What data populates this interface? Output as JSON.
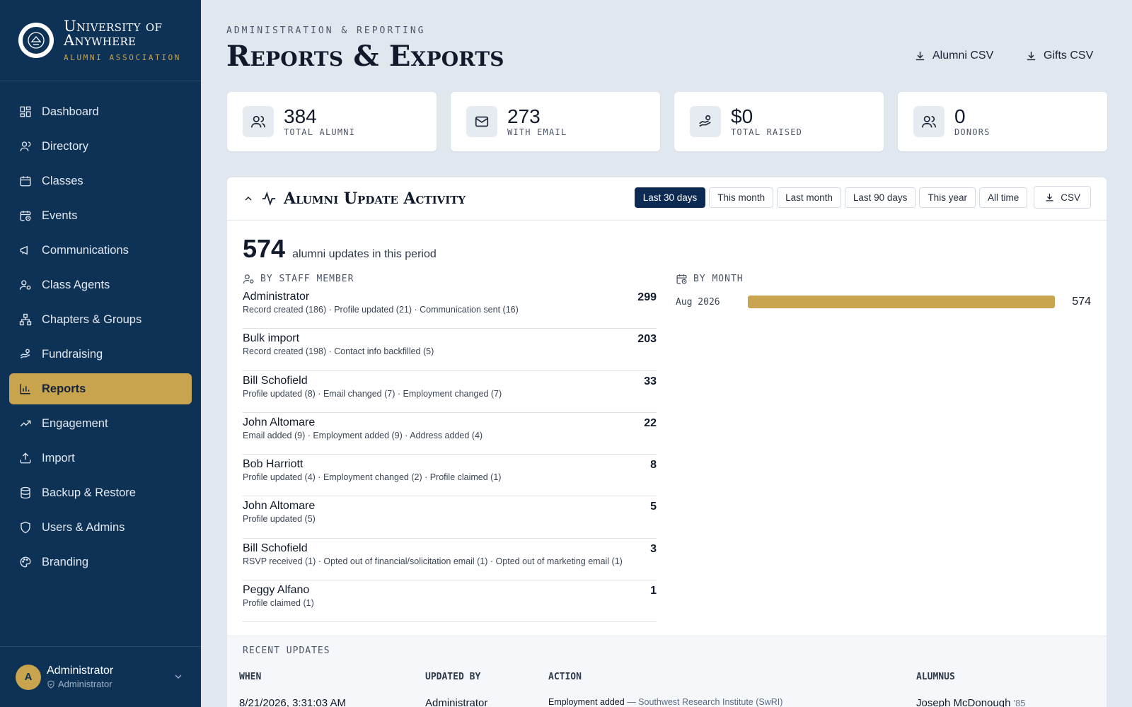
{
  "brand": {
    "name_line1": "University of",
    "name_line2": "Anywhere",
    "subtitle": "Alumni Association"
  },
  "sidebar": {
    "items": [
      {
        "label": "Dashboard",
        "icon": "dashboard-icon"
      },
      {
        "label": "Directory",
        "icon": "user-icon"
      },
      {
        "label": "Classes",
        "icon": "calendar-icon"
      },
      {
        "label": "Events",
        "icon": "calendar-clock-icon"
      },
      {
        "label": "Communications",
        "icon": "megaphone-icon"
      },
      {
        "label": "Class Agents",
        "icon": "user-gear-icon"
      },
      {
        "label": "Chapters & Groups",
        "icon": "network-icon"
      },
      {
        "label": "Fundraising",
        "icon": "hand-coins-icon"
      },
      {
        "label": "Reports",
        "icon": "bar-chart-icon",
        "active": true
      },
      {
        "label": "Engagement",
        "icon": "trending-up-icon"
      },
      {
        "label": "Import",
        "icon": "upload-icon"
      },
      {
        "label": "Backup & Restore",
        "icon": "database-icon"
      },
      {
        "label": "Users & Admins",
        "icon": "shield-icon"
      },
      {
        "label": "Branding",
        "icon": "palette-icon"
      }
    ],
    "user": {
      "initial": "A",
      "name": "Administrator",
      "role": "Administrator"
    }
  },
  "header": {
    "eyebrow": "Administration & Reporting",
    "title": "Reports & Exports",
    "export_alumni": "Alumni CSV",
    "export_gifts": "Gifts CSV"
  },
  "stats": [
    {
      "value": "384",
      "label": "Total Alumni",
      "icon": "users-icon"
    },
    {
      "value": "273",
      "label": "With Email",
      "icon": "mail-icon"
    },
    {
      "value": "$0",
      "label": "Total Raised",
      "icon": "hand-coins-icon"
    },
    {
      "value": "0",
      "label": "Donors",
      "icon": "users-icon"
    }
  ],
  "activity": {
    "title": "Alumni Update Activity",
    "filters": [
      "Last 30 days",
      "This month",
      "Last month",
      "Last 90 days",
      "This year",
      "All time"
    ],
    "active_filter": "Last 30 days",
    "csv_label": "CSV",
    "total": "574",
    "total_label": "alumni updates in this period",
    "by_staff_label": "By Staff Member",
    "by_month_label": "By Month",
    "staff": [
      {
        "name": "Administrator",
        "detail": "Record created (186) · Profile updated (21) · Communication sent (16)",
        "count": "299"
      },
      {
        "name": "Bulk import",
        "detail": "Record created (198) · Contact info backfilled (5)",
        "count": "203"
      },
      {
        "name": "Bill Schofield",
        "detail": "Profile updated (8) · Email changed (7) · Employment changed (7)",
        "count": "33"
      },
      {
        "name": "John Altomare",
        "detail": "Email added (9) · Employment added (9) · Address added (4)",
        "count": "22"
      },
      {
        "name": "Bob Harriott",
        "detail": "Profile updated (4) · Employment changed (2) · Profile claimed (1)",
        "count": "8"
      },
      {
        "name": "John Altomare",
        "detail": "Profile updated (5)",
        "count": "5"
      },
      {
        "name": "Bill Schofield",
        "detail": "RSVP received (1) · Opted out of financial/solicitation email (1) · Opted out of marketing email (1)",
        "count": "3"
      },
      {
        "name": "Peggy Alfano",
        "detail": "Profile claimed (1)",
        "count": "1"
      }
    ],
    "months": [
      {
        "label": "Aug 2026",
        "value": "574",
        "fraction": 1.0
      }
    ]
  },
  "recent": {
    "label": "Recent Updates",
    "columns": [
      "When",
      "Updated By",
      "Action",
      "Alumnus"
    ],
    "rows": [
      {
        "when": "8/21/2026, 3:31:03 AM",
        "by": "Administrator",
        "action": "Employment added",
        "action_detail": "— Southwest Research Institute (SwRI)",
        "alumnus": "Joseph McDonough",
        "class_year": "'85"
      }
    ]
  },
  "colors": {
    "sidebar": "#0d3256",
    "accent": "#c9a44f",
    "background": "#e1e7ef",
    "active_chip": "#0d2b52"
  }
}
